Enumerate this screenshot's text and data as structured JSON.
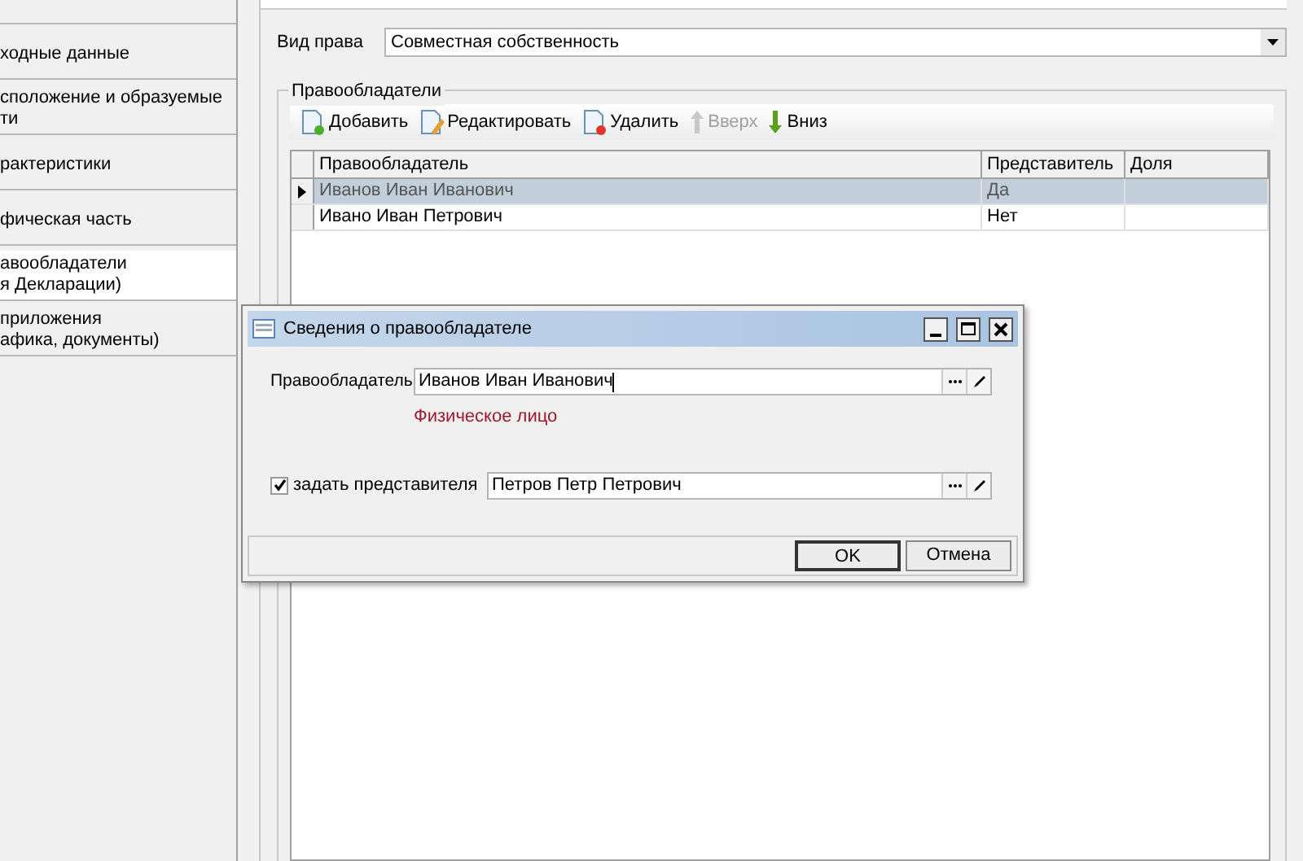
{
  "sidebar": {
    "items": [
      {
        "selected": false
      },
      {
        "text": "ходные данные",
        "selected": false
      },
      {
        "text": "сположение и образуемые\nти",
        "selected": false
      },
      {
        "text": "рактеристики",
        "selected": false
      },
      {
        "text": "фическая часть",
        "selected": false
      },
      {
        "text": "авообладатели\nя Декларации)",
        "selected": true
      },
      {
        "text": "приложения\nафика, документы)",
        "selected": false
      }
    ]
  },
  "right_type": {
    "label": "Вид права",
    "value": "Совместная собственность"
  },
  "owners": {
    "title": "Правообладатели",
    "toolbar": [
      {
        "kind": "add",
        "label": "Добавить",
        "disabled": false
      },
      {
        "kind": "edit",
        "label": "Редактировать",
        "disabled": false
      },
      {
        "kind": "delete",
        "label": "Удалить",
        "disabled": false
      },
      {
        "kind": "up",
        "label": "Вверх",
        "disabled": true
      },
      {
        "kind": "down",
        "label": "Вниз",
        "disabled": false
      }
    ],
    "columns": [
      "Правообладатель",
      "Представитель",
      "Доля"
    ],
    "rows": [
      {
        "cells": [
          "Иванов Иван Иванович",
          "Да",
          ""
        ],
        "selected": true
      },
      {
        "cells": [
          "Ивано Иван Петрович",
          "Нет",
          ""
        ],
        "selected": false
      }
    ]
  },
  "dialog": {
    "title": "Сведения о правообладателе",
    "owner_label": "Правообладатель",
    "owner_value": "Иванов Иван Иванович",
    "owner_type": "Физическое лицо",
    "rep_checkbox": {
      "label": "задать представителя",
      "checked": true
    },
    "rep_value": "Петров Петр Петрович",
    "buttons": [
      "OK",
      "Отмена"
    ]
  }
}
